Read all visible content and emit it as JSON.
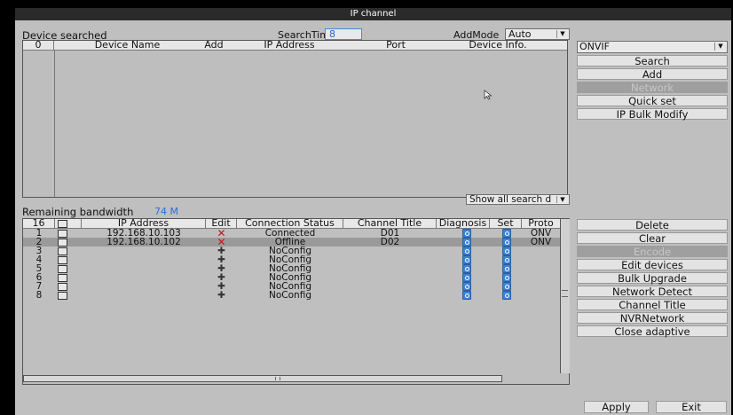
{
  "title": "IP channel",
  "search": {
    "device_searched_label": "Device searched",
    "search_time_label": "SearchTime",
    "search_time_value": "8",
    "add_mode_label": "AddMode",
    "add_mode_value": "Auto",
    "columns": [
      "0",
      "Device Name",
      "Add",
      "IP Address",
      "Port",
      "Device Info."
    ],
    "show_all_value": "Show all search d"
  },
  "protocol": {
    "value": "ONVIF"
  },
  "right_buttons_top": [
    {
      "label": "Search",
      "enabled": true
    },
    {
      "label": "Add",
      "enabled": true
    },
    {
      "label": "Network",
      "enabled": false
    },
    {
      "label": "Quick set",
      "enabled": true
    },
    {
      "label": "IP Bulk Modify",
      "enabled": true
    }
  ],
  "bandwidth": {
    "label": "Remaining bandwidth",
    "value": "74 M"
  },
  "channels": {
    "columns": [
      "16",
      "",
      "IP Address",
      "Edit",
      "Connection Status",
      "Channel Title",
      "Diagnosis",
      "Set",
      "Proto"
    ],
    "rows": [
      {
        "num": "1",
        "ip": "192.168.10.103",
        "edit": "x",
        "status": "Connected",
        "title": "D01",
        "proto": "ONV",
        "selected": false
      },
      {
        "num": "2",
        "ip": "192.168.10.102",
        "edit": "x",
        "status": "Offline",
        "title": "D02",
        "proto": "ONV",
        "selected": true
      },
      {
        "num": "3",
        "ip": "",
        "edit": "+",
        "status": "NoConfig",
        "title": "",
        "proto": "",
        "selected": false
      },
      {
        "num": "4",
        "ip": "",
        "edit": "+",
        "status": "NoConfig",
        "title": "",
        "proto": "",
        "selected": false
      },
      {
        "num": "5",
        "ip": "",
        "edit": "+",
        "status": "NoConfig",
        "title": "",
        "proto": "",
        "selected": false
      },
      {
        "num": "6",
        "ip": "",
        "edit": "+",
        "status": "NoConfig",
        "title": "",
        "proto": "",
        "selected": false
      },
      {
        "num": "7",
        "ip": "",
        "edit": "+",
        "status": "NoConfig",
        "title": "",
        "proto": "",
        "selected": false
      },
      {
        "num": "8",
        "ip": "",
        "edit": "+",
        "status": "NoConfig",
        "title": "",
        "proto": "",
        "selected": false
      }
    ]
  },
  "right_buttons_bottom": [
    {
      "label": "Delete",
      "enabled": true
    },
    {
      "label": "Clear",
      "enabled": true
    },
    {
      "label": "Encode",
      "enabled": false
    },
    {
      "label": "Edit devices",
      "enabled": true
    },
    {
      "label": "Bulk Upgrade",
      "enabled": true
    },
    {
      "label": "Network Detect",
      "enabled": true
    },
    {
      "label": "Channel Title",
      "enabled": true
    },
    {
      "label": "NVRNetwork",
      "enabled": true
    },
    {
      "label": "Close adaptive",
      "enabled": true
    }
  ],
  "footer": {
    "apply": "Apply",
    "exit": "Exit"
  }
}
